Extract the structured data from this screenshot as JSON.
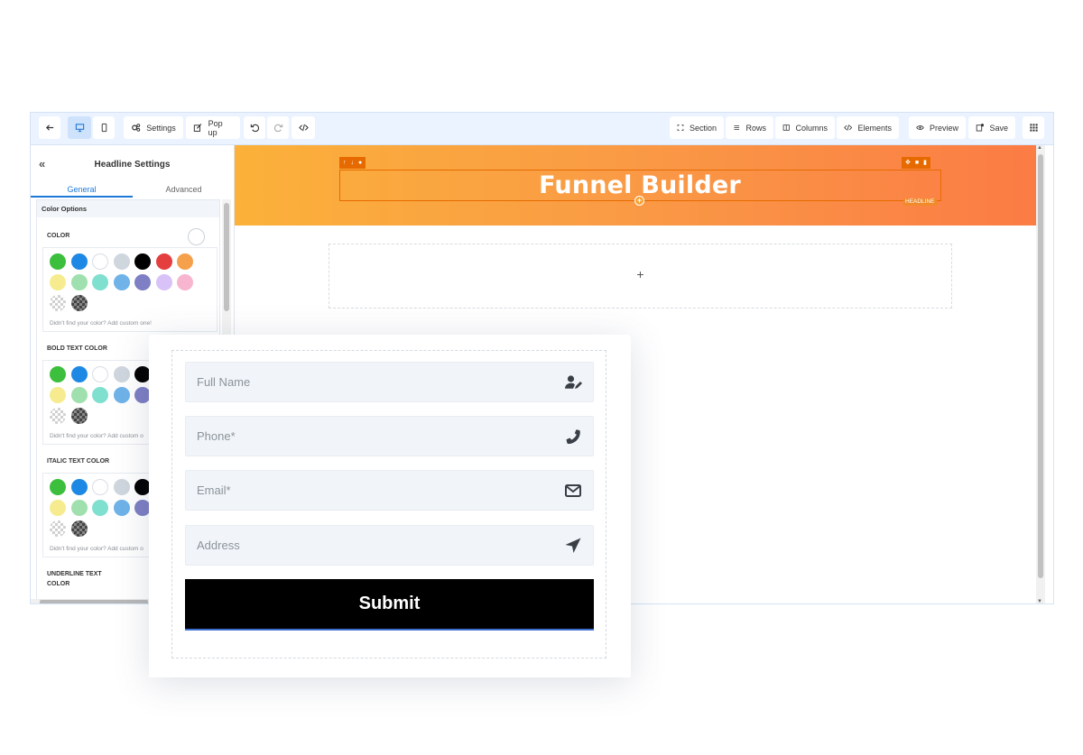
{
  "toolbar": {
    "settings_label": "Settings",
    "popup_label": "Pop up",
    "section_label": "Section",
    "rows_label": "Rows",
    "columns_label": "Columns",
    "elements_label": "Elements",
    "preview_label": "Preview",
    "save_label": "Save"
  },
  "panel": {
    "title": "Headline Settings",
    "tabs": [
      "General",
      "Advanced"
    ],
    "group_title": "Color Options",
    "sections": [
      {
        "label": "COLOR",
        "hint": "Didn't find your color? Add custom one!"
      },
      {
        "label": "BOLD TEXT COLOR",
        "hint": "Didn't find your color? Add custom o"
      },
      {
        "label": "ITALIC TEXT COLOR",
        "hint": "Didn't find your color? Add custom o"
      },
      {
        "label": "UNDERLINE TEXT COLOR"
      }
    ],
    "underline_line1": "UNDERLINE TEXT",
    "underline_line2": "COLOR",
    "swatch_colors": [
      "#3cbf3c",
      "#1e88e5",
      "#ffffff",
      "#cfd6de",
      "#000000",
      "#e53e3e",
      "#f5a04a",
      "#f6ec8f",
      "#9fe0ae",
      "#7fe0d0",
      "#6fb3e8",
      "#7e7fc4",
      "#d9c2f7",
      "#f7b5cf"
    ]
  },
  "canvas": {
    "headline": "Funnel Builder",
    "element_tag": "HEADLINE",
    "drop_plus": "+"
  },
  "form": {
    "fields": [
      {
        "placeholder": "Full Name",
        "icon": "user-edit-icon"
      },
      {
        "placeholder": "Phone*",
        "icon": "phone-icon"
      },
      {
        "placeholder": "Email*",
        "icon": "envelope-icon"
      },
      {
        "placeholder": "Address",
        "icon": "location-arrow-icon"
      }
    ],
    "submit_label": "Submit"
  },
  "colors": {
    "accent": "#1e78d7",
    "hero_start": "#fbb13a",
    "hero_end": "#fb7b45",
    "selection": "#e66a00"
  }
}
